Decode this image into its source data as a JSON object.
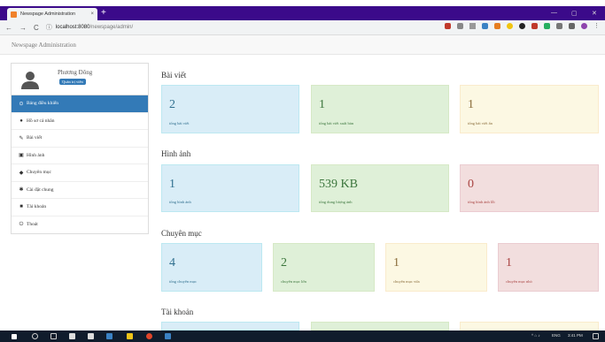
{
  "browser": {
    "tab_title": "Newspage Administration",
    "tab_close": "×",
    "new_tab": "+",
    "window_controls": [
      "—",
      "▢",
      "✕"
    ],
    "url_host": "localhost:8080",
    "url_path": "/newspage/admin/"
  },
  "app": {
    "header_title": "Newspage Administration"
  },
  "profile": {
    "name": "Phương Đông",
    "role": "Quản trị viên"
  },
  "menu": [
    {
      "label": "Bảng điều khiển",
      "icon": "dashboard-icon",
      "glyph": "⊙",
      "active": true
    },
    {
      "label": "Hồ sơ cá nhân",
      "icon": "user-icon",
      "glyph": "●",
      "active": false
    },
    {
      "label": "Bài viết",
      "icon": "edit-icon",
      "glyph": "✎",
      "active": false
    },
    {
      "label": "Hình ảnh",
      "icon": "picture-icon",
      "glyph": "▣",
      "active": false
    },
    {
      "label": "Chuyên mục",
      "icon": "tag-icon",
      "glyph": "◆",
      "active": false
    },
    {
      "label": "Cài đặt chung",
      "icon": "gear-icon",
      "glyph": "✱",
      "active": false
    },
    {
      "label": "Tài khoản",
      "icon": "lock-icon",
      "glyph": "■",
      "active": false
    },
    {
      "label": "Thoát",
      "icon": "power-icon",
      "glyph": "⏻",
      "active": false
    }
  ],
  "sections": {
    "posts": {
      "title": "Bài viết",
      "cards": [
        {
          "value": "2",
          "label": "tổng bài viết",
          "color": "blue"
        },
        {
          "value": "1",
          "label": "tổng bài viết xuất bản",
          "color": "green"
        },
        {
          "value": "1",
          "label": "tổng bài viết ẩn",
          "color": "yellow"
        }
      ]
    },
    "images": {
      "title": "Hình ảnh",
      "cards": [
        {
          "value": "1",
          "label": "tổng hình ảnh",
          "color": "blue"
        },
        {
          "value": "539 KB",
          "label": "tổng dung lượng ảnh",
          "color": "green"
        },
        {
          "value": "0",
          "label": "tổng hình ảnh lỗi",
          "color": "red"
        }
      ]
    },
    "categories": {
      "title": "Chuyên mục",
      "cards": [
        {
          "value": "4",
          "label": "tổng chuyên mục",
          "color": "blue"
        },
        {
          "value": "2",
          "label": "chuyên mục lớn",
          "color": "green"
        },
        {
          "value": "1",
          "label": "chuyên mục vừa",
          "color": "yellow"
        },
        {
          "value": "1",
          "label": "chuyên mục nhỏ",
          "color": "red"
        }
      ]
    },
    "accounts": {
      "title": "Tài khoản"
    }
  },
  "taskbar": {
    "time": "3:41 PM",
    "lang": "ENG"
  },
  "colors": {
    "primary": "#337ab7",
    "tabbar": "#3b0a8a",
    "taskbar": "#101c2c"
  }
}
